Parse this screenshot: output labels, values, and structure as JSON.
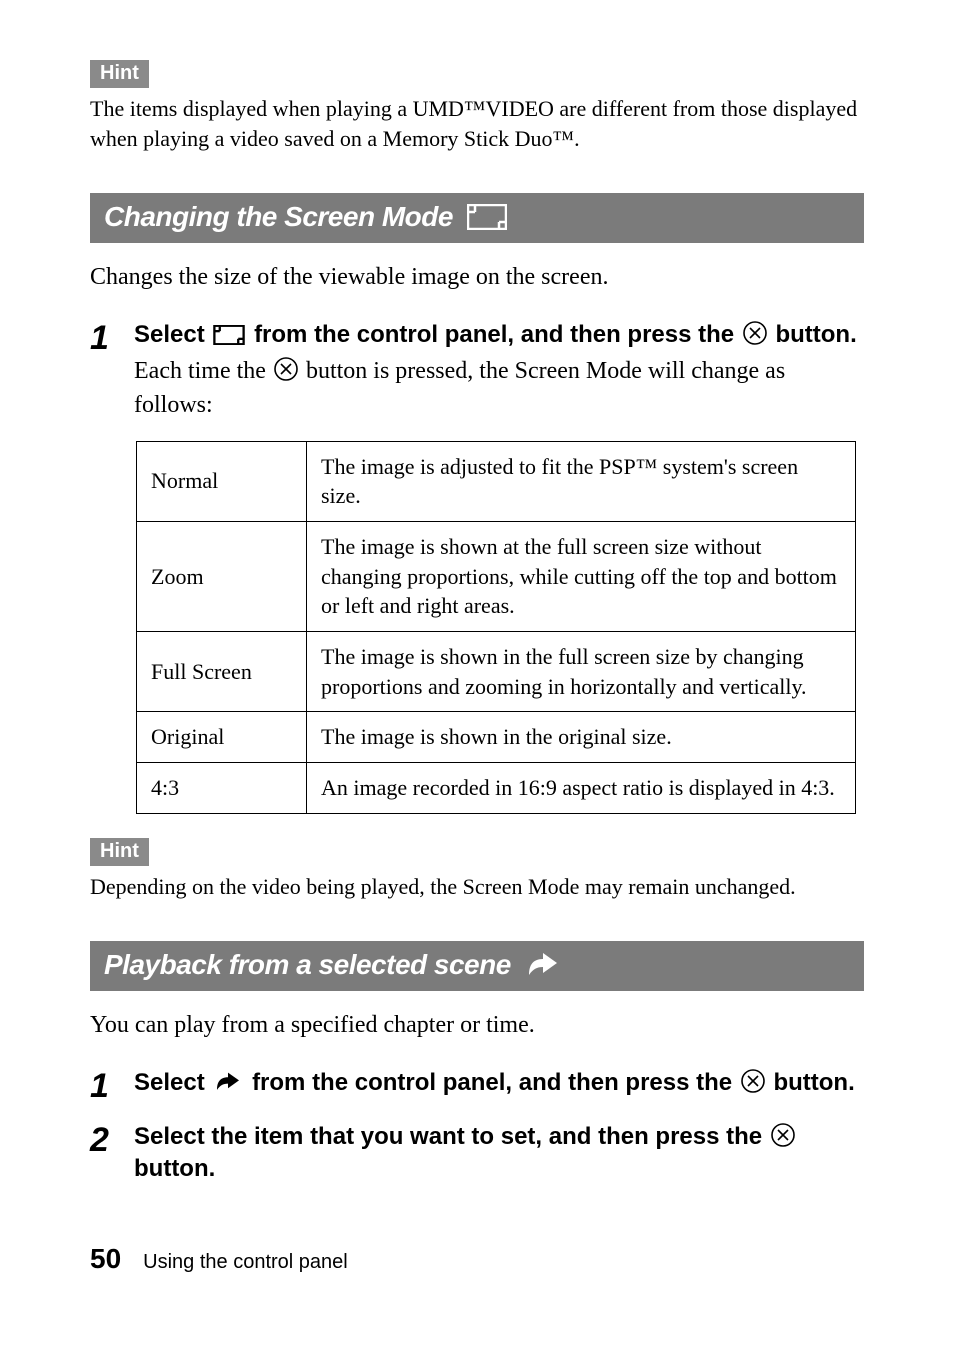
{
  "hints": {
    "label": "Hint",
    "top_text": "The items displayed when playing a UMD™VIDEO are different from those displayed when playing a video saved on a Memory Stick Duo™.",
    "mid_text": "Depending on the video being played, the Screen Mode may remain unchanged."
  },
  "section1": {
    "title": "Changing the Screen Mode",
    "lead": "Changes the size of the viewable image on the screen.",
    "step1_pre": "Select ",
    "step1_mid": " from the control panel, and then press the ",
    "step1_post": " button.",
    "step1_desc_pre": "Each time the ",
    "step1_desc_post": " button is pressed, the Screen Mode will change as follows:",
    "table": [
      {
        "k": "Normal",
        "v": "The image is adjusted to fit the PSP™ system's screen size."
      },
      {
        "k": "Zoom",
        "v": "The image is shown at the full screen size without changing proportions, while cutting off the top and bottom or left and right areas."
      },
      {
        "k": "Full Screen",
        "v": "The image is shown in the full screen size by changing proportions and zooming in horizontally and vertically."
      },
      {
        "k": "Original",
        "v": "The image is shown in the original size."
      },
      {
        "k": "4:3",
        "v": "An image recorded in 16:9 aspect ratio is displayed in 4:3."
      }
    ]
  },
  "section2": {
    "title": "Playback from a selected scene",
    "lead": "You can play from a specified chapter or time.",
    "step1_pre": "Select ",
    "step1_mid": " from the control panel, and then press the ",
    "step1_post": " button.",
    "step2_pre": "Select the item that you want to set, and then press the ",
    "step2_post": " button."
  },
  "footer": {
    "page": "50",
    "title": "Using the control panel"
  },
  "nums": {
    "one": "1",
    "two": "2"
  }
}
